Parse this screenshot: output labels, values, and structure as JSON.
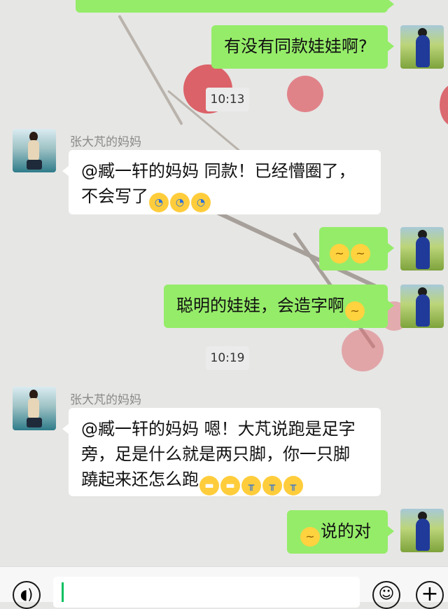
{
  "colors": {
    "outgoing": "#95ec69",
    "incoming": "#ffffff",
    "cursor": "#07c160"
  },
  "chat": {
    "top_partial_text": "…",
    "messages": [
      {
        "text": "有没有同款娃娃啊?"
      },
      {
        "time": "10:13"
      },
      {
        "sender": "张大芃的妈妈",
        "text1": "@臧一轩的妈妈  同款！已经懵圈了，",
        "text2": "不会写了"
      },
      {
        "emojis": "thinking-face thinking-face"
      },
      {
        "text": "聪明的娃娃，会造字啊"
      },
      {
        "time": "10:19"
      },
      {
        "sender": "张大芃的妈妈",
        "text1": "@臧一轩的妈妈  嗯！大芃说跑是足字",
        "text2": "旁，足是什么就是两只脚，你一只脚",
        "text3": "蹺起来还怎么跑"
      },
      {
        "text": "说的对"
      }
    ]
  },
  "input": {
    "voice_icon": "voice-icon",
    "emoji_icon": "emoji-icon",
    "plus_icon": "plus-icon"
  }
}
